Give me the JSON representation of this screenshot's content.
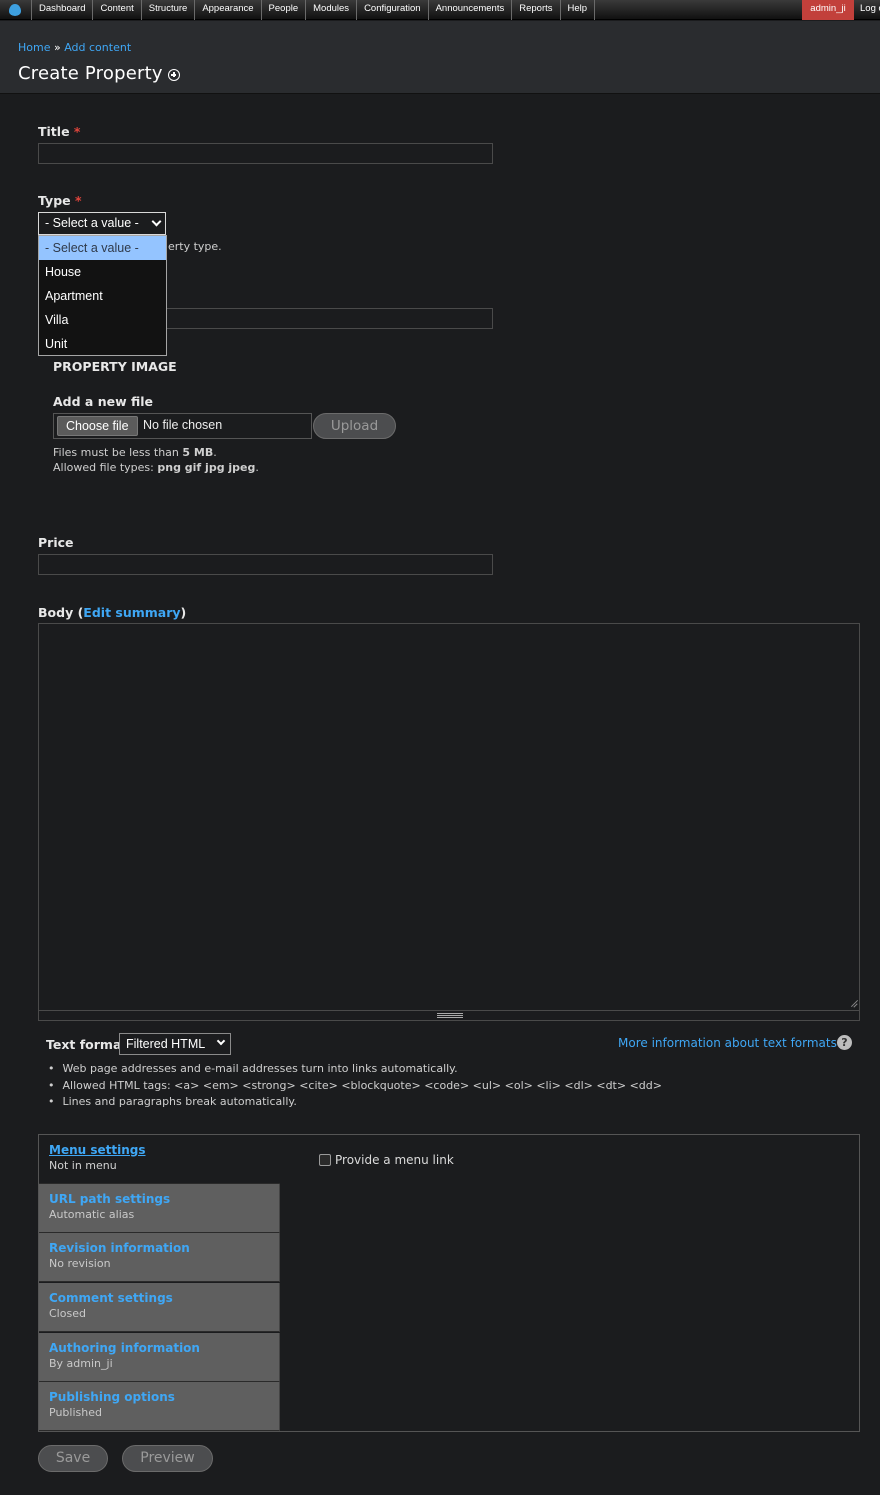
{
  "toolbar": {
    "items": [
      "Dashboard",
      "Content",
      "Structure",
      "Appearance",
      "People",
      "Modules",
      "Configuration",
      "Announcements",
      "Reports",
      "Help"
    ],
    "user": "admin_ji",
    "logout": "Log out"
  },
  "breadcrumb": {
    "home": "Home",
    "separator": "»",
    "current": "Add content"
  },
  "page_title": "Create Property",
  "form": {
    "title_label": "Title",
    "required_mark": "*",
    "type_label": "Type",
    "type_value": "- Select a value -",
    "type_options": [
      "- Select a value -",
      "House",
      "Apartment",
      "Villa",
      "Unit"
    ],
    "type_desc_visible": "erty type.",
    "property_image_label": "PROPERTY IMAGE",
    "add_file_label": "Add a new file",
    "choose_file": "Choose file",
    "no_file": "No file chosen",
    "upload": "Upload",
    "file_help_size_prefix": "Files must be less than",
    "file_help_size": "5 MB",
    "file_help_types_prefix": "Allowed file types:",
    "file_help_types": "png gif jpg jpeg",
    "price_label": "Price",
    "body_label": "Body",
    "edit_summary": "Edit summary",
    "text_format_label": "Text format",
    "text_format_value": "Filtered HTML",
    "more_info": "More information about text formats",
    "format_tips": [
      "Web page addresses and e-mail addresses turn into links automatically.",
      "Allowed HTML tags: <a> <em> <strong> <cite> <blockquote> <code> <ul> <ol> <li> <dl> <dt> <dd>",
      "Lines and paragraphs break automatically."
    ]
  },
  "vertical_tabs": [
    {
      "title": "Menu settings",
      "summary": "Not in menu"
    },
    {
      "title": "URL path settings",
      "summary": "Automatic alias"
    },
    {
      "title": "Revision information",
      "summary": "No revision"
    },
    {
      "title": "Comment settings",
      "summary": "Closed"
    },
    {
      "title": "Authoring information",
      "summary": "By admin_ji"
    },
    {
      "title": "Publishing options",
      "summary": "Published"
    }
  ],
  "menu_link_label": "Provide a menu link",
  "actions": {
    "save": "Save",
    "preview": "Preview"
  },
  "colors": {
    "accent_link": "#3fa7f5",
    "user_badge": "#c2403b",
    "background": "#1b1c1e",
    "required": "#e0453c"
  }
}
